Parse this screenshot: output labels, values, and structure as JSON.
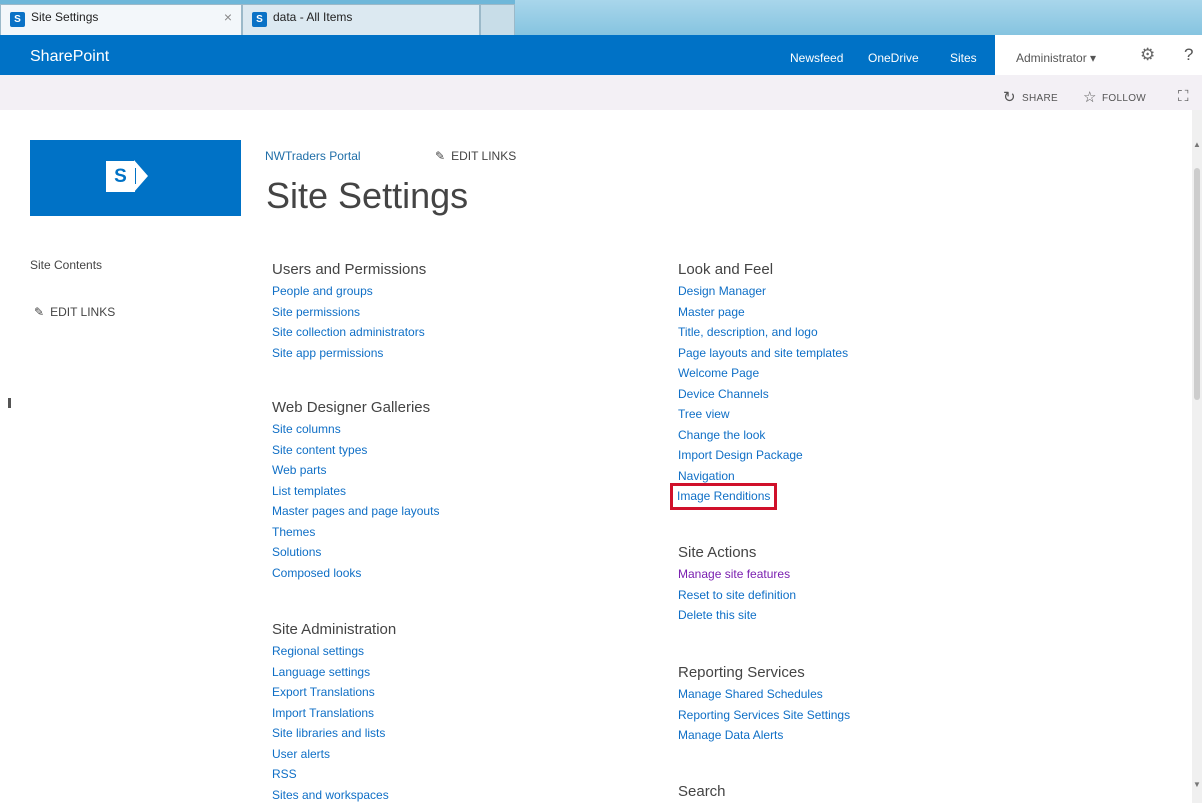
{
  "browser": {
    "tabs": [
      {
        "label": "Site Settings",
        "active": true
      },
      {
        "label": "data - All Items",
        "active": false
      }
    ],
    "close_glyph": "×"
  },
  "suitebar": {
    "brand": "SharePoint",
    "links": [
      "Newsfeed",
      "OneDrive",
      "Sites"
    ],
    "user": "Administrator ▾",
    "help": "?",
    "colors": {
      "bar": "#0072c6"
    }
  },
  "actions": {
    "share": "SHARE",
    "follow": "FOLLOW"
  },
  "header": {
    "breadcrumb": "NWTraders Portal",
    "edit_links": "EDIT LINKS",
    "title": "Site Settings"
  },
  "leftnav": {
    "site_contents": "Site Contents",
    "edit_links": "EDIT LINKS"
  },
  "sections": {
    "users": {
      "title": "Users and Permissions",
      "links": [
        "People and groups",
        "Site permissions",
        "Site collection administrators",
        "Site app permissions"
      ]
    },
    "web_designer": {
      "title": "Web Designer Galleries",
      "links": [
        "Site columns",
        "Site content types",
        "Web parts",
        "List templates",
        "Master pages and page layouts",
        "Themes",
        "Solutions",
        "Composed looks"
      ]
    },
    "site_admin": {
      "title": "Site Administration",
      "links": [
        "Regional settings",
        "Language settings",
        "Export Translations",
        "Import Translations",
        "Site libraries and lists",
        "User alerts",
        "RSS",
        "Sites and workspaces"
      ]
    },
    "look_feel": {
      "title": "Look and Feel",
      "links": [
        "Design Manager",
        "Master page",
        "Title, description, and logo",
        "Page layouts and site templates",
        "Welcome Page",
        "Device Channels",
        "Tree view",
        "Change the look",
        "Import Design Package",
        "Navigation",
        "Image Renditions"
      ],
      "highlighted": "Image Renditions"
    },
    "site_actions": {
      "title": "Site Actions",
      "links": [
        "Manage site features",
        "Reset to site definition",
        "Delete this site"
      ]
    },
    "reporting": {
      "title": "Reporting Services",
      "links": [
        "Manage Shared Schedules",
        "Reporting Services Site Settings",
        "Manage Data Alerts"
      ]
    },
    "search": {
      "title": "Search"
    }
  }
}
